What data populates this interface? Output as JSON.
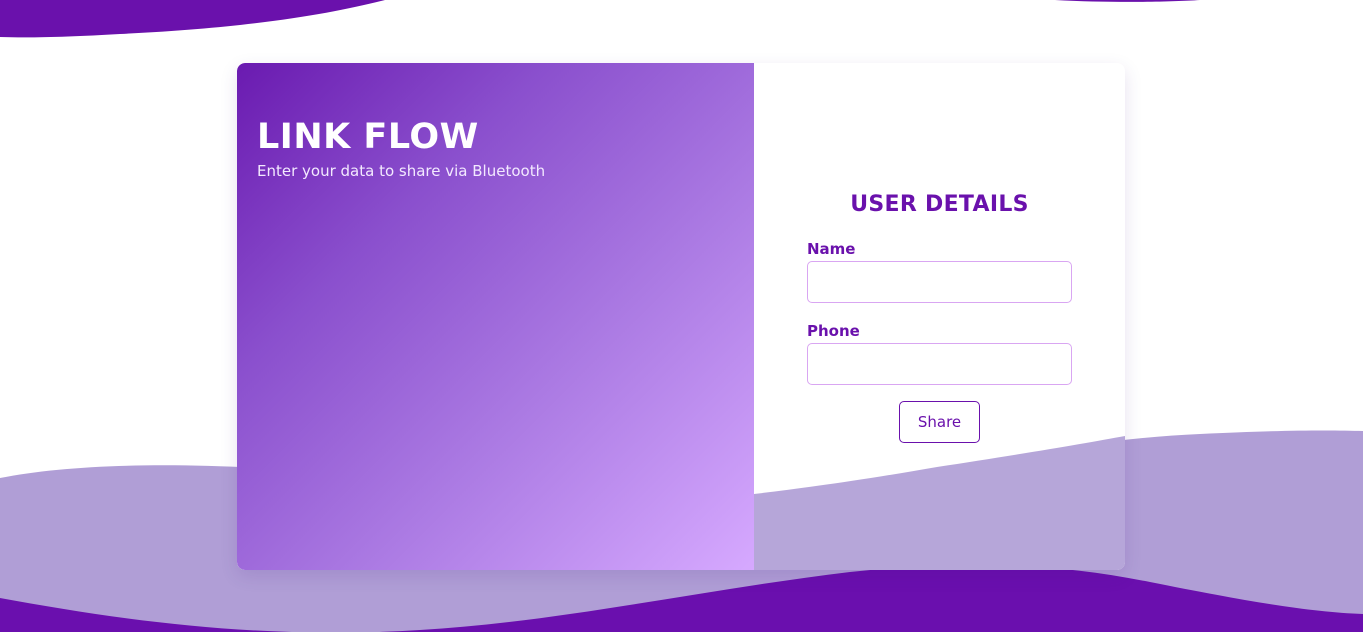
{
  "hero": {
    "title": "LINK FLOW",
    "subtitle": "Enter your data to share via Bluetooth"
  },
  "form": {
    "heading": "USER DETAILS",
    "name_label": "Name",
    "name_value": "",
    "phone_label": "Phone",
    "phone_value": "",
    "share_label": "Share"
  },
  "colors": {
    "primary": "#6a11ac",
    "wave_light": "#b19fd6",
    "gradient_start": "#6a1ab0",
    "gradient_end": "#d6a9ff",
    "input_border": "#d9a6f2"
  }
}
